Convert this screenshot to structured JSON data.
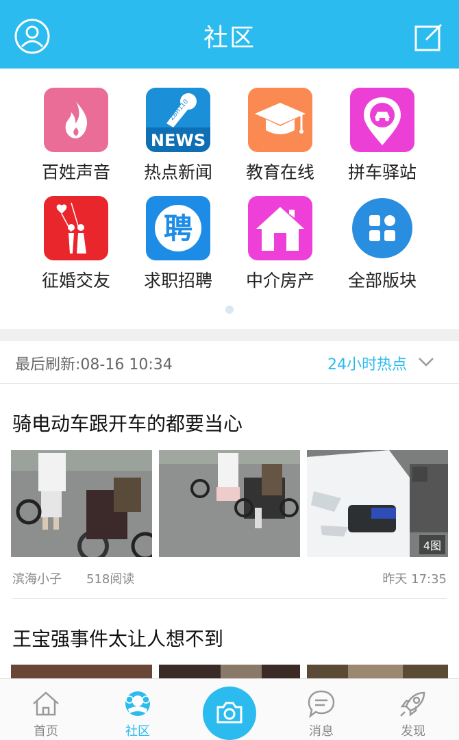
{
  "header": {
    "title": "社区"
  },
  "categories": [
    {
      "label": "百姓声音",
      "icon": "flame-icon",
      "color": "#ea6d97"
    },
    {
      "label": "热点新闻",
      "icon": "news-microphone-icon",
      "color": "#1b8fd8",
      "badge": "NEWS",
      "mic_text": "ZBH110"
    },
    {
      "label": "教育在线",
      "icon": "graduation-cap-icon",
      "color": "#fa8a52"
    },
    {
      "label": "拼车驿站",
      "icon": "car-pin-icon",
      "color": "#ec3fd6"
    },
    {
      "label": "征婚交友",
      "icon": "couple-balloons-icon",
      "color": "#e8262c"
    },
    {
      "label": "求职招聘",
      "icon": "recruit-icon",
      "color": "#1d8ce6",
      "glyph": "聘"
    },
    {
      "label": "中介房产",
      "icon": "house-icon",
      "color": "#ee3fd8"
    },
    {
      "label": "全部版块",
      "icon": "all-sections-icon",
      "color": "#2a8ee0"
    }
  ],
  "refresh": {
    "last_refresh": "最后刷新:08-16 10:34",
    "filter": "24小时热点"
  },
  "posts": [
    {
      "title": "骑电动车跟开车的都要当心",
      "author": "滨海小子",
      "reads": "518阅读",
      "time": "昨天 17:35",
      "image_count": "4图"
    },
    {
      "title": "王宝强事件太让人想不到"
    }
  ],
  "tabs": [
    {
      "label": "首页",
      "icon": "home-icon"
    },
    {
      "label": "社区",
      "icon": "community-icon",
      "active": true
    },
    {
      "label": "",
      "icon": "camera-icon"
    },
    {
      "label": "消息",
      "icon": "message-icon"
    },
    {
      "label": "发现",
      "icon": "rocket-icon"
    }
  ],
  "colors": {
    "accent": "#2bbbef",
    "background": "#ffffff",
    "separator": "#f0f0f0"
  }
}
